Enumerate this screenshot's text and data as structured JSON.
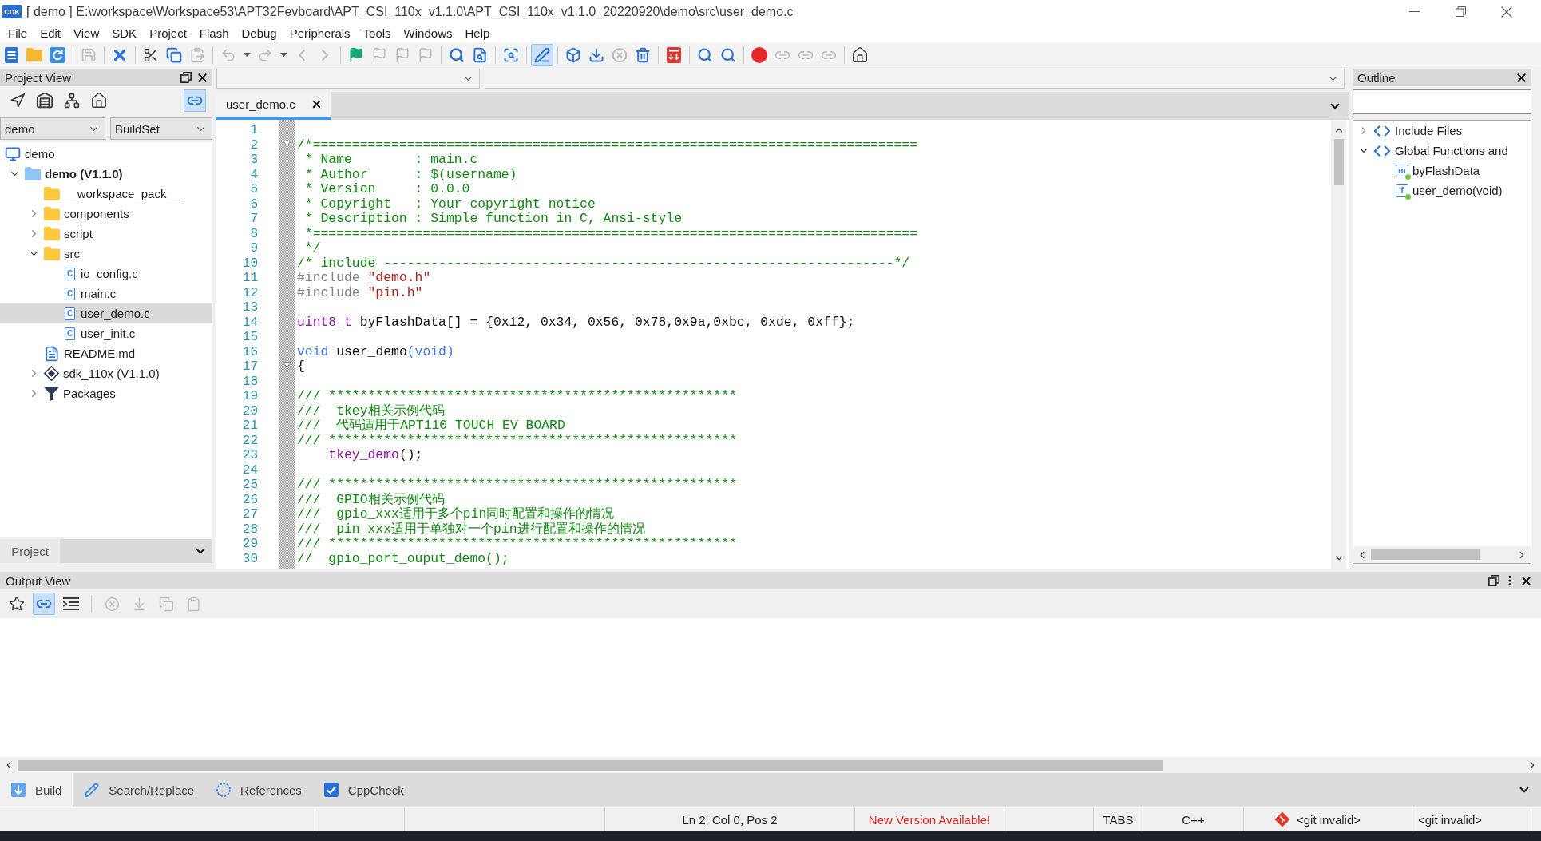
{
  "window": {
    "logo": "CDK",
    "title": "[ demo ] E:\\workspace\\Workspace53\\APT32Fevboard\\APT_CSI_110x_v1.1.0\\APT_CSI_110x_v1.1.0_20220920\\demo\\src\\user_demo.c"
  },
  "menu": [
    "File",
    "Edit",
    "View",
    "SDK",
    "Project",
    "Flash",
    "Debug",
    "Peripherals",
    "Tools",
    "Windows",
    "Help"
  ],
  "toolbar": {
    "groups": [
      [
        {
          "disabled": false,
          "pressed": false
        },
        {
          "disabled": false,
          "pressed": false
        },
        {
          "disabled": false,
          "pressed": false
        }
      ],
      [
        {
          "disabled": true,
          "pressed": false
        }
      ],
      [
        {
          "disabled": false,
          "pressed": false
        }
      ],
      [
        {
          "disabled": false,
          "pressed": false
        },
        {
          "disabled": false,
          "pressed": false
        },
        {
          "disabled": true,
          "pressed": false
        }
      ],
      [
        {
          "disabled": true,
          "pressed": false
        },
        {
          "disabled": false,
          "pressed": false
        },
        {
          "disabled": true,
          "pressed": false
        },
        {
          "disabled": false,
          "pressed": false
        },
        {
          "disabled": true,
          "pressed": false
        },
        {
          "disabled": true,
          "pressed": false
        }
      ],
      [
        {
          "disabled": false,
          "pressed": false
        },
        {
          "disabled": true,
          "pressed": false
        },
        {
          "disabled": true,
          "pressed": false
        },
        {
          "disabled": true,
          "pressed": false
        }
      ],
      [
        {
          "disabled": false,
          "pressed": false
        },
        {
          "disabled": false,
          "pressed": false
        }
      ],
      [
        {
          "disabled": false,
          "pressed": false
        }
      ],
      [
        {
          "disabled": false,
          "pressed": true
        }
      ],
      [
        {
          "disabled": false,
          "pressed": false
        },
        {
          "disabled": false,
          "pressed": false
        },
        {
          "disabled": true,
          "pressed": false
        },
        {
          "disabled": false,
          "pressed": false
        }
      ],
      [
        {
          "disabled": false,
          "pressed": false
        }
      ],
      [
        {
          "disabled": false,
          "pressed": false
        },
        {
          "disabled": false,
          "pressed": false
        }
      ],
      [
        {
          "disabled": false,
          "pressed": false
        },
        {
          "disabled": true,
          "pressed": false
        },
        {
          "disabled": true,
          "pressed": false
        },
        {
          "disabled": true,
          "pressed": false
        }
      ],
      [
        {
          "disabled": false,
          "pressed": false
        }
      ]
    ]
  },
  "project_view": {
    "title": "Project View",
    "tools": [
      [
        {
          "pressed": false
        },
        {
          "pressed": false
        },
        {
          "pressed": false
        },
        {
          "pressed": false
        }
      ],
      [
        {
          "pressed": true
        }
      ]
    ],
    "project_select": "demo",
    "build_select": "BuildSet",
    "workspace": {
      "label": "demo"
    },
    "tree": [
      {
        "label": "demo (V1.1.0)",
        "kind": "project",
        "expanded": true,
        "selected": false,
        "active": true,
        "children": [
          {
            "label": "__workspace_pack__",
            "kind": "folder",
            "selected": false,
            "active": false
          },
          {
            "label": "components",
            "kind": "folder",
            "expanded": false,
            "selected": false,
            "active": false
          },
          {
            "label": "script",
            "kind": "folder",
            "expanded": false,
            "selected": false,
            "active": false
          },
          {
            "label": "src",
            "kind": "folder",
            "expanded": true,
            "selected": false,
            "active": false,
            "children": [
              {
                "label": "io_config.c",
                "kind": "source",
                "glyph": "C",
                "selected": false,
                "active": false
              },
              {
                "label": "main.c",
                "kind": "source",
                "glyph": "C",
                "selected": false,
                "active": false
              },
              {
                "label": "user_demo.c",
                "kind": "source",
                "glyph": "C",
                "selected": true,
                "active": false
              },
              {
                "label": "user_init.c",
                "kind": "source",
                "glyph": "C",
                "selected": false,
                "active": false
              }
            ]
          },
          {
            "label": "README.md",
            "kind": "document",
            "selected": false,
            "active": false
          },
          {
            "label": "sdk_110x (V1.1.0)",
            "kind": "component",
            "expanded": false,
            "selected": false,
            "active": false
          },
          {
            "label": "Packages",
            "kind": "packages",
            "expanded": false,
            "selected": false,
            "active": false
          }
        ]
      }
    ],
    "footer": {
      "label": "Project"
    }
  },
  "editor": {
    "tabs": [
      {
        "label": "user_demo.c",
        "selected": true
      }
    ],
    "lines": [
      {
        "number": "1",
        "fold_marker": false
      },
      {
        "number": "2",
        "fold_marker": true,
        "segments": [
          {
            "kind": "comment",
            "text": "/*============================================================================="
          }
        ]
      },
      {
        "number": "3",
        "fold_marker": false,
        "segments": [
          {
            "kind": "comment",
            "text": " * Name        : main.c"
          }
        ]
      },
      {
        "number": "4",
        "fold_marker": false,
        "segments": [
          {
            "kind": "comment",
            "text": " * Author      : $(username)"
          }
        ]
      },
      {
        "number": "5",
        "fold_marker": false,
        "segments": [
          {
            "kind": "comment",
            "text": " * Version     : 0.0.0"
          }
        ]
      },
      {
        "number": "6",
        "fold_marker": false,
        "segments": [
          {
            "kind": "comment",
            "text": " * Copyright   : Your copyright notice"
          }
        ]
      },
      {
        "number": "7",
        "fold_marker": false,
        "segments": [
          {
            "kind": "comment",
            "text": " * Description : Simple function in C, Ansi-style"
          }
        ]
      },
      {
        "number": "8",
        "fold_marker": false,
        "segments": [
          {
            "kind": "comment",
            "text": " *============================================================================="
          }
        ]
      },
      {
        "number": "9",
        "fold_marker": false,
        "segments": [
          {
            "kind": "comment",
            "text": " */"
          }
        ]
      },
      {
        "number": "10",
        "fold_marker": false,
        "segments": [
          {
            "kind": "comment",
            "text": "/* include -----------------------------------------------------------------*/"
          }
        ]
      },
      {
        "number": "11",
        "fold_marker": false,
        "segments": [
          {
            "kind": "preproc",
            "text": "#include "
          },
          {
            "kind": "string",
            "text": "\"demo.h\""
          }
        ]
      },
      {
        "number": "12",
        "fold_marker": false,
        "segments": [
          {
            "kind": "preproc",
            "text": "#include "
          },
          {
            "kind": "string",
            "text": "\"pin.h\""
          }
        ]
      },
      {
        "number": "13",
        "fold_marker": false
      },
      {
        "number": "14",
        "fold_marker": false,
        "segments": [
          {
            "kind": "type",
            "text": "uint8_t"
          },
          {
            "kind": "plain",
            "text": " byFlashData[] = {0x12, 0x34, 0x56, 0x78,0x9a,0xbc, 0xde, 0xff};"
          }
        ]
      },
      {
        "number": "15",
        "fold_marker": false
      },
      {
        "number": "16",
        "fold_marker": false,
        "segments": [
          {
            "kind": "keyword",
            "text": "void"
          },
          {
            "kind": "plain",
            "text": " user_demo"
          },
          {
            "kind": "keyword",
            "text": "(void)"
          }
        ]
      },
      {
        "number": "17",
        "fold_marker": true,
        "segments": [
          {
            "kind": "plain",
            "text": "{"
          }
        ]
      },
      {
        "number": "18",
        "fold_marker": false
      },
      {
        "number": "19",
        "fold_marker": false,
        "segments": [
          {
            "kind": "comment",
            "text": "/// ****************************************************"
          }
        ]
      },
      {
        "number": "20",
        "fold_marker": false,
        "segments": [
          {
            "kind": "comment",
            "text": "///  tkey相关示例代码"
          }
        ]
      },
      {
        "number": "21",
        "fold_marker": false,
        "segments": [
          {
            "kind": "comment",
            "text": "///  代码适用于APT110 TOUCH EV BOARD"
          }
        ]
      },
      {
        "number": "22",
        "fold_marker": false,
        "segments": [
          {
            "kind": "comment",
            "text": "/// ****************************************************"
          }
        ]
      },
      {
        "number": "23",
        "fold_marker": false,
        "segments": [
          {
            "kind": "function",
            "text": "    tkey_demo"
          },
          {
            "kind": "plain",
            "text": "();"
          }
        ]
      },
      {
        "number": "24",
        "fold_marker": false
      },
      {
        "number": "25",
        "fold_marker": false,
        "segments": [
          {
            "kind": "comment",
            "text": "/// ****************************************************"
          }
        ]
      },
      {
        "number": "26",
        "fold_marker": false,
        "segments": [
          {
            "kind": "comment",
            "text": "///  GPIO相关示例代码"
          }
        ]
      },
      {
        "number": "27",
        "fold_marker": false,
        "segments": [
          {
            "kind": "comment",
            "text": "///  gpio_xxx适用于多个pin同时配置和操作的情况"
          }
        ]
      },
      {
        "number": "28",
        "fold_marker": false,
        "segments": [
          {
            "kind": "comment",
            "text": "///  pin_xxx适用于单独对一个pin进行配置和操作的情况"
          }
        ]
      },
      {
        "number": "29",
        "fold_marker": false,
        "segments": [
          {
            "kind": "comment",
            "text": "/// ****************************************************"
          }
        ]
      },
      {
        "number": "30",
        "fold_marker": false,
        "segments": [
          {
            "kind": "comment",
            "text": "//  gpio_port_ouput_demo();"
          }
        ]
      }
    ]
  },
  "outline": {
    "title": "Outline",
    "tree": [
      {
        "label": "Include Files",
        "kind": "group",
        "expanded": false,
        "selected": false
      },
      {
        "label": "Global Functions and",
        "kind": "group",
        "expanded": true,
        "selected": false,
        "children": [
          {
            "label": "byFlashData",
            "kind": "symbol",
            "glyph": "m",
            "selected": false
          },
          {
            "label": "user_demo(void)",
            "kind": "symbol",
            "glyph": "f",
            "selected": false
          }
        ]
      }
    ]
  },
  "output_view": {
    "title": "Output View",
    "tools": [
      [
        {
          "disabled": false,
          "pressed": false
        },
        {
          "disabled": false,
          "pressed": true
        },
        {
          "disabled": false,
          "pressed": false
        }
      ],
      [
        {
          "disabled": true,
          "pressed": false
        },
        {
          "disabled": true,
          "pressed": false
        },
        {
          "disabled": true,
          "pressed": false
        },
        {
          "disabled": true,
          "pressed": false
        }
      ]
    ],
    "tabs": [
      {
        "label": "Build",
        "selected": true
      },
      {
        "label": "Search/Replace",
        "selected": false
      },
      {
        "label": "References",
        "selected": false
      },
      {
        "label": "CppCheck",
        "selected": false
      }
    ]
  },
  "status_bar": [
    {
      "kind": "blank"
    },
    {
      "kind": "blank"
    },
    {
      "kind": "blank"
    },
    {
      "kind": "text",
      "text": "Ln 2, Col 0, Pos 2"
    },
    {
      "kind": "alert",
      "text": "New Version Available!"
    },
    {
      "kind": "blank"
    },
    {
      "kind": "text",
      "text": "TABS"
    },
    {
      "kind": "text",
      "text": "C++"
    },
    {
      "kind": "git",
      "text": "<git invalid>"
    },
    {
      "kind": "branch",
      "text": "<git invalid>"
    }
  ]
}
